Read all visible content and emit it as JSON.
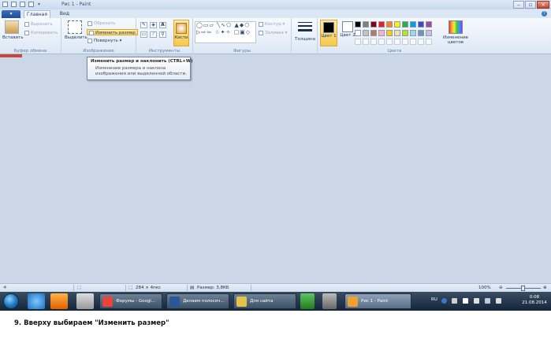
{
  "window": {
    "title": "Рис 1 - Paint"
  },
  "tabs": {
    "file": "▾",
    "home": "Главная",
    "view": "Вид"
  },
  "ribbon": {
    "clipboard": {
      "paste": "Вставить",
      "cut": "Вырезать",
      "copy": "Копировать",
      "label": "Буфер обмена"
    },
    "image": {
      "select": "Выделить",
      "crop": "Обрезать",
      "resize": "Изменить размер",
      "rotate": "Повернуть",
      "label": "Изображение"
    },
    "tools": {
      "label": "Инструменты",
      "text_glyph": "A",
      "brushes": "Кисти"
    },
    "shapes": {
      "glyphs": "◯▭▱ ╲∿⬠ ▲◆⬡ ▷⇨⇦ ☆✦✧ ▢▣◇",
      "outline": "Контур",
      "fill": "Заливка",
      "label": "Фигуры"
    },
    "size": {
      "label": "Толщина"
    },
    "colors": {
      "color1": "Цвет 1",
      "color2": "Цвет 2",
      "edit": "Изменение цветов",
      "label": "Цвета",
      "color1_value": "#000000",
      "color2_value": "#ffffff",
      "palette_row1": [
        "#000000",
        "#7f7f7f",
        "#880015",
        "#ed1c24",
        "#ff7f27",
        "#fff200",
        "#22b14c",
        "#00a2e8",
        "#3f48cc",
        "#a349a4"
      ],
      "palette_row2": [
        "#ffffff",
        "#c3c3c3",
        "#b97a57",
        "#ffaec9",
        "#ffc90e",
        "#efe4b0",
        "#b5e61d",
        "#99d9ea",
        "#7092be",
        "#c8bfe7"
      ]
    }
  },
  "tooltip": {
    "title": "Изменить размер и наклонить (CTRL+W)",
    "description": "Изменение размера и наклона изображения или выделенной области."
  },
  "status": {
    "selection": "284 × 4пкс",
    "size": "Размер: 3,8КБ",
    "zoom": "100%",
    "zoom_fraction": 0.5
  },
  "taskbar": {
    "tasks": [
      {
        "label": "Форумы - Googl...",
        "icon_color": "#e8443a"
      },
      {
        "label": "Делаем полосоч...",
        "icon_color": "#2b579a"
      },
      {
        "label": "Для сайта",
        "icon_color": "#e7c24a"
      },
      {
        "label": "Рис 1 - Paint",
        "icon_color": "#f0a030"
      }
    ],
    "language": "RU",
    "clock_time": "0:08",
    "clock_date": "21.08.2014"
  },
  "caption": "9. Вверху выбираем \"Изменить размер\""
}
